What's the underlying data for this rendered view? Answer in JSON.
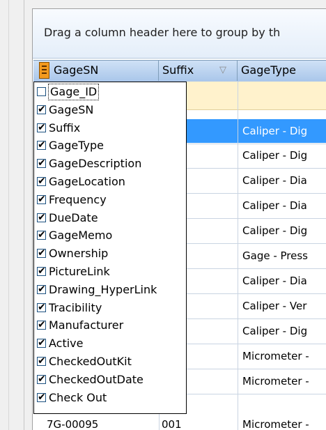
{
  "group_panel": {
    "hint": "Drag a column header here to group by th"
  },
  "headers": {
    "gagesn": "GageSN",
    "suffix": "Suffix",
    "gagetype": "GageType"
  },
  "column_chooser": [
    {
      "label": "Gage_ID",
      "checked": false
    },
    {
      "label": "GageSN",
      "checked": true
    },
    {
      "label": "Suffix",
      "checked": true
    },
    {
      "label": "GageType",
      "checked": true
    },
    {
      "label": "GageDescription",
      "checked": true
    },
    {
      "label": "GageLocation",
      "checked": true
    },
    {
      "label": "Frequency",
      "checked": true
    },
    {
      "label": "DueDate",
      "checked": true
    },
    {
      "label": "GageMemo",
      "checked": true
    },
    {
      "label": "Ownership",
      "checked": true
    },
    {
      "label": "PictureLink",
      "checked": true
    },
    {
      "label": "Drawing_HyperLink",
      "checked": true
    },
    {
      "label": "Tracibility",
      "checked": true
    },
    {
      "label": "Manufacturer",
      "checked": true
    },
    {
      "label": "Active",
      "checked": true
    },
    {
      "label": "CheckedOutKit",
      "checked": true
    },
    {
      "label": "CheckedOutDate",
      "checked": true
    },
    {
      "label": "Check Out",
      "checked": true
    }
  ],
  "gagetype_cells": [
    "Caliper - Dig",
    "Caliper - Dig",
    "Caliper - Dia",
    "Caliper - Dia",
    "Caliper - Dig",
    "Gage - Press",
    "Caliper - Dia",
    "Caliper - Ver",
    "Caliper - Dig",
    "Micrometer -",
    "Micrometer -"
  ],
  "last_row": {
    "gagesn": "7G-00095",
    "suffix": "001",
    "gagetype": "Micrometer -"
  },
  "colors": {
    "selection": "#3399ff",
    "header": "#b9d1ee",
    "filter_row": "#fff2cc"
  }
}
